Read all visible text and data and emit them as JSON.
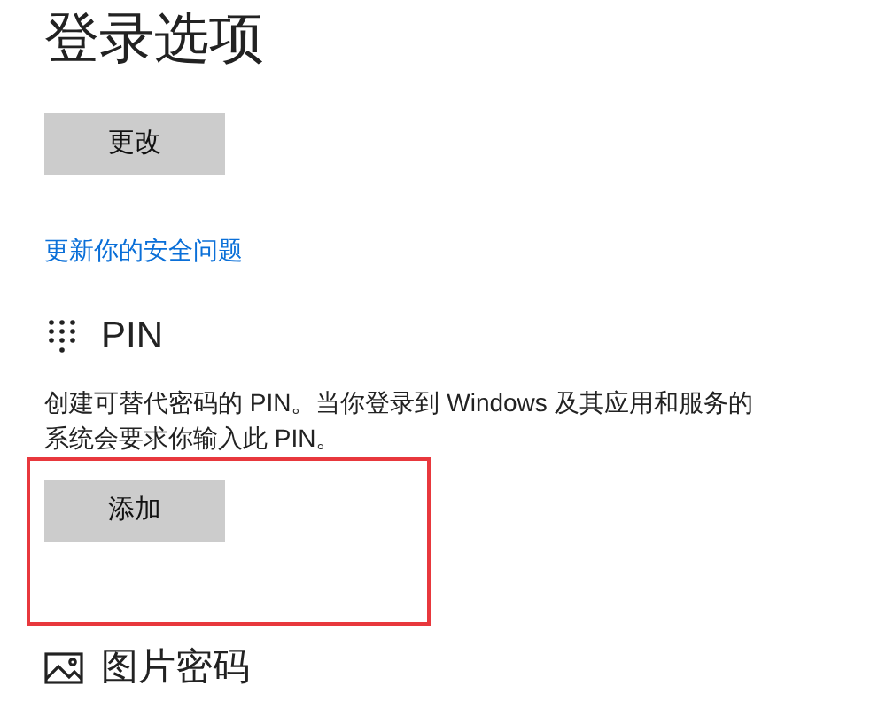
{
  "title": "登录选项",
  "password": {
    "button": "更改",
    "link": "更新你的安全问题"
  },
  "pin": {
    "heading": "PIN",
    "description_lines": [
      "创建可替代密码的 PIN。当你登录到 Windows 及其应用和服务的",
      "系统会要求你输入此 PIN。"
    ],
    "button": "添加"
  },
  "picture_password": {
    "heading": "图片密码"
  }
}
